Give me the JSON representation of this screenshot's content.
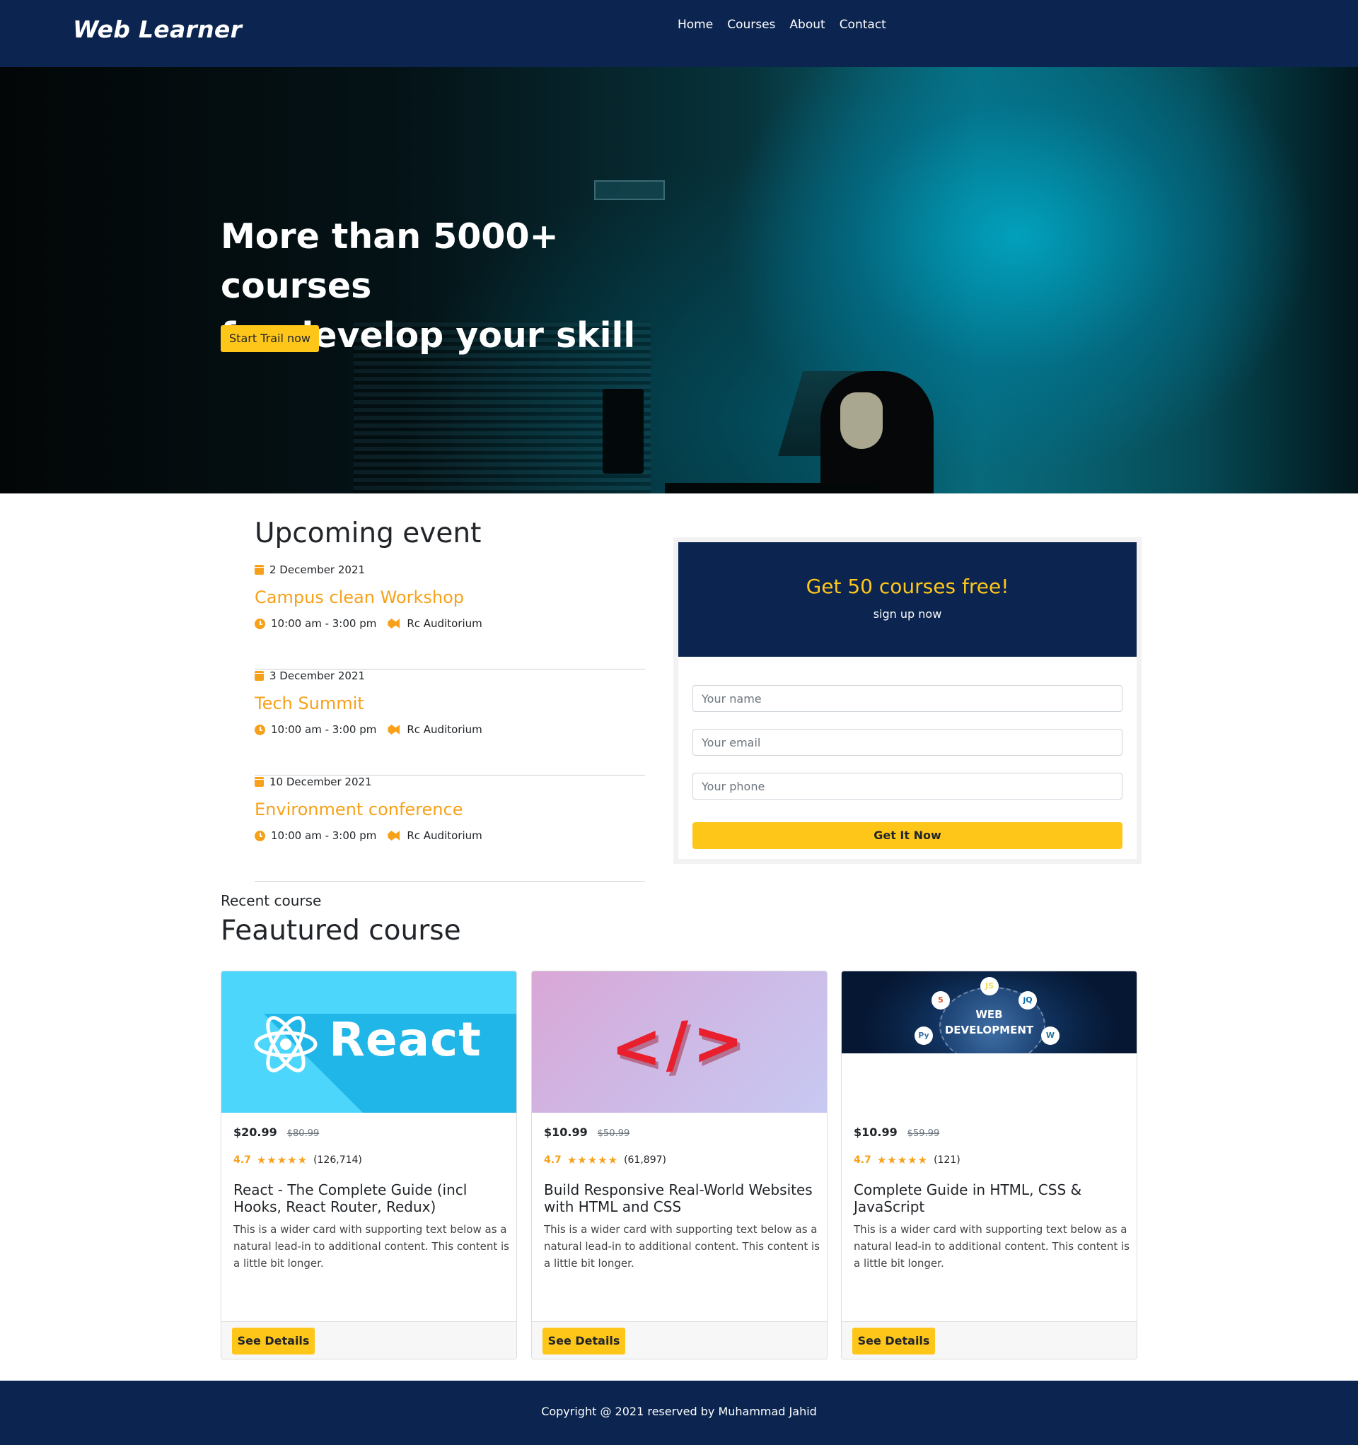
{
  "brand": "Web Learner",
  "nav": [
    "Home",
    "Courses",
    "About",
    "Contact"
  ],
  "hero": {
    "title_line1": "More than 5000+ courses",
    "title_line2": "for develop your skill",
    "button": "Start Trail now"
  },
  "events": {
    "title": "Upcoming event",
    "items": [
      {
        "date": "2 December 2021",
        "name": "Campus clean Workshop",
        "time": "10:00 am - 3:00 pm",
        "location": "Rc Auditorium"
      },
      {
        "date": "3 December 2021",
        "name": "Tech Summit",
        "time": "10:00 am - 3:00 pm",
        "location": "Rc Auditorium"
      },
      {
        "date": "10 December 2021",
        "name": "Environment conference",
        "time": "10:00 am - 3:00 pm",
        "location": "Rc Auditorium"
      }
    ]
  },
  "signup": {
    "title": "Get 50 courses free!",
    "subtitle": "sign up now",
    "name_placeholder": "Your name",
    "email_placeholder": "Your email",
    "phone_placeholder": "Your phone",
    "button": "Get It Now"
  },
  "courses": {
    "label": "Recent course",
    "title": "Feautured course",
    "items": [
      {
        "image_text": "React",
        "price": "$20.99",
        "old_price": "$80.99",
        "rating": "4.7",
        "stars": "★★★★★",
        "reviews": "(126,714)",
        "title": "React - The Complete Guide (incl Hooks, React Router, Redux)",
        "text": "This is a wider card with supporting text below as a natural lead-in to additional content. This content is a little bit longer.",
        "button": "See Details"
      },
      {
        "image_text": "</>",
        "price": "$10.99",
        "old_price": "$50.99",
        "rating": "4.7",
        "stars": "★★★★★",
        "reviews": "(61,897)",
        "title": "Build Responsive Real-World Websites with HTML and CSS",
        "text": "This is a wider card with supporting text below as a natural lead-in to additional content. This content is a little bit longer.",
        "button": "See Details"
      },
      {
        "image_text_1": "WEB",
        "image_text_2": "DEVELOPMENT",
        "price": "$10.99",
        "old_price": "$59.99",
        "rating": "4.7",
        "stars": "★★★★★",
        "reviews": "(121)",
        "title": "Complete Guide in HTML, CSS & JavaScript",
        "text": "This is a wider card with supporting text below as a natural lead-in to additional content. This content is a little bit longer.",
        "button": "See Details"
      }
    ]
  },
  "footer": "Copyright @ 2021 reserved by Muhammad Jahid",
  "colors": {
    "navy": "#0b2550",
    "accent": "#ffc61a",
    "event_orange": "#f7a11a"
  },
  "icons": {
    "date": "calendar-icon",
    "time": "clock-icon",
    "location": "map-icon",
    "rating": "star-icon"
  }
}
